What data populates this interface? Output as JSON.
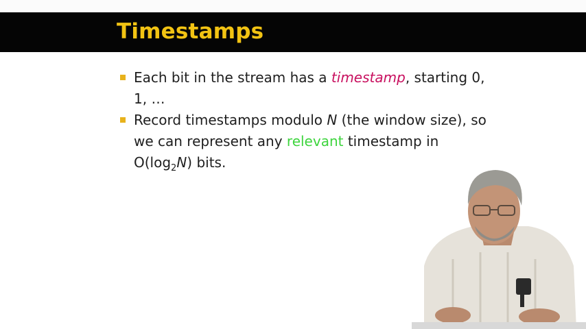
{
  "slide": {
    "title": "Timestamps",
    "bullets": [
      {
        "pre": "Each bit in the stream has a ",
        "emph": "timestamp",
        "post": ", starting 0, 1, …"
      },
      {
        "pre": "Record timestamps modulo ",
        "var": "N",
        "mid": " (the window size), so we can represent any ",
        "highlight": "relevant",
        "post1": " timestamp in O(log",
        "sub": "2",
        "var2": "N",
        "post2": ") bits."
      }
    ]
  },
  "colors": {
    "title": "#f2c313",
    "title_bar": "#050505",
    "bullet_marker": "#e8b21c",
    "emphasis": "#c8105f",
    "highlight": "#3dd43d"
  }
}
